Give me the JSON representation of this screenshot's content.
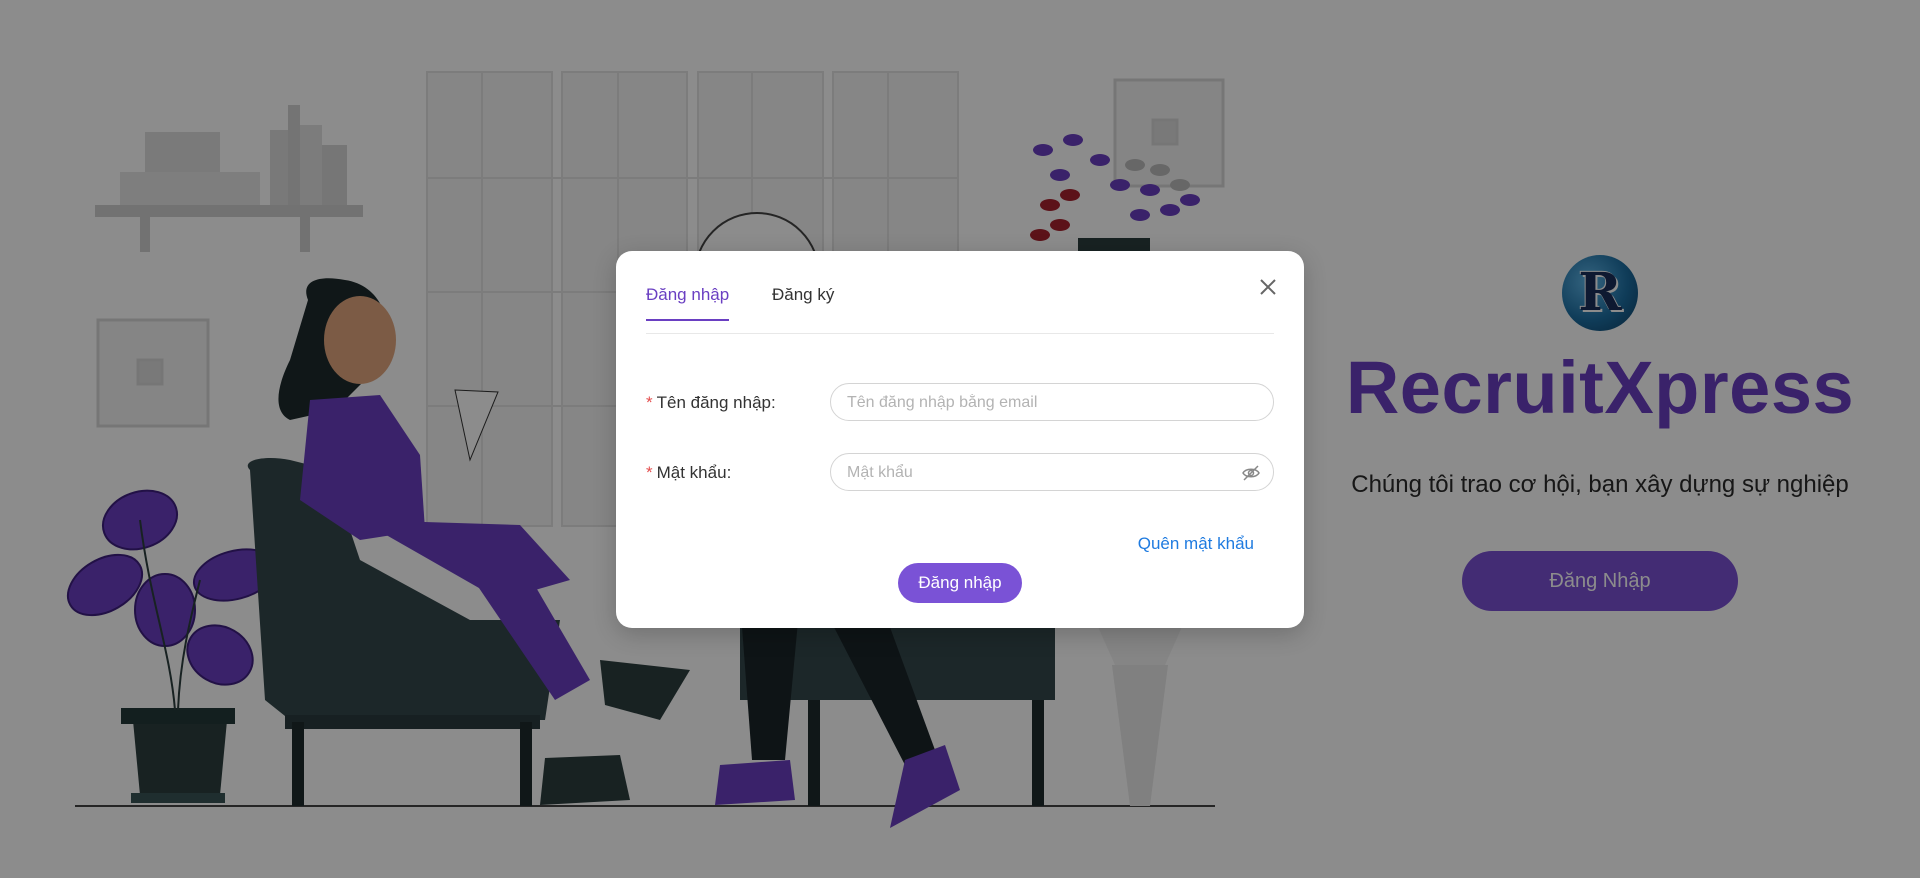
{
  "hero": {
    "logo_letter": "R",
    "brand": "RecruitXpress",
    "tagline": "Chúng tôi trao cơ hội, bạn xây dựng sự nghiệp",
    "login_button": "Đăng Nhập"
  },
  "modal": {
    "tabs": [
      {
        "label": "Đăng nhập",
        "active": true
      },
      {
        "label": "Đăng ký",
        "active": false
      }
    ],
    "fields": {
      "username": {
        "label": "Tên đăng nhập",
        "required_mark": "*",
        "placeholder": "Tên đăng nhập bằng email",
        "value": ""
      },
      "password": {
        "label": "Mật khẩu",
        "required_mark": "*",
        "placeholder": "Mật khẩu",
        "value": ""
      }
    },
    "forgot_password": "Quên mật khẩu",
    "submit_label": "Đăng nhập",
    "close_icon": "close-icon",
    "password_toggle_icon": "eye-off-icon"
  },
  "colors": {
    "accent": "#6a3fc2",
    "button": "#7a52d6",
    "link": "#1f7be0",
    "required": "#e34d4d"
  }
}
